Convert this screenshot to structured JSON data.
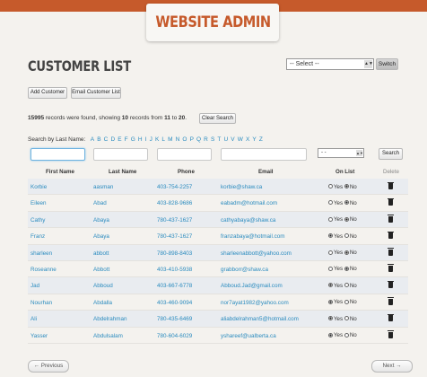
{
  "header": {
    "title": "WEBSITE ADMIN"
  },
  "page": {
    "title": "CUSTOMER LIST"
  },
  "site_select": {
    "value": "-- Select --",
    "switch_label": "Switch"
  },
  "actions": {
    "add": "Add Customer",
    "email": "Email Customer List",
    "clear": "Clear Search"
  },
  "summary": {
    "count": "15995",
    "text1": " records were found, showing ",
    "shown": "10",
    "text2": " records from ",
    "from": "11",
    "text3": " to ",
    "to": "20",
    "text4": "."
  },
  "alpha": {
    "label": "Search by Last Name:",
    "letters": [
      "A",
      "B",
      "C",
      "D",
      "E",
      "F",
      "G",
      "H",
      "I",
      "J",
      "K",
      "L",
      "M",
      "N",
      "O",
      "P",
      "Q",
      "R",
      "S",
      "T",
      "U",
      "V",
      "W",
      "X",
      "Y",
      "Z"
    ]
  },
  "filters": {
    "onlist_value": "- -",
    "search_label": "Search"
  },
  "columns": {
    "first": "First Name",
    "last": "Last Name",
    "phone": "Phone",
    "email": "Email",
    "onlist": "On List",
    "delete": "Delete"
  },
  "radio": {
    "yes": "Yes",
    "no": "No"
  },
  "rows": [
    {
      "first": "Korbie",
      "last": "aasman",
      "phone": "403-754-2257",
      "email": "korbie@shaw.ca",
      "on_list": "No"
    },
    {
      "first": "Eileen",
      "last": "Abad",
      "phone": "403-828-9686",
      "email": "eabadm@hotmail.com",
      "on_list": "No"
    },
    {
      "first": "Cathy",
      "last": "Abaya",
      "phone": "780-437-1627",
      "email": "cathyabaya@shaw.ca",
      "on_list": "No"
    },
    {
      "first": "Franz",
      "last": "Abaya",
      "phone": "780-437-1627",
      "email": "franzabaya@hotmail.com",
      "on_list": "Yes"
    },
    {
      "first": "sharleen",
      "last": "abbott",
      "phone": "780-898-8403",
      "email": "sharleenabbott@yahoo.com",
      "on_list": "No"
    },
    {
      "first": "Roseanne",
      "last": "Abbott",
      "phone": "403-410-5938",
      "email": "grabborr@shaw.ca",
      "on_list": "No"
    },
    {
      "first": "Jad",
      "last": "Abboud",
      "phone": "403-667-6778",
      "email": "Abboud.Jad@gmail.com",
      "on_list": "Yes"
    },
    {
      "first": "Nourhan",
      "last": "Abdalla",
      "phone": "403-460-9094",
      "email": "nor7ayat1982@yahoo.com",
      "on_list": "Yes"
    },
    {
      "first": "Ali",
      "last": "Abdelrahman",
      "phone": "780-435-6469",
      "email": "aliabdelrahman5@hotmail.com",
      "on_list": "Yes"
    },
    {
      "first": "Yasser",
      "last": "Abdulsalam",
      "phone": "780-604-6029",
      "email": "yshareef@ualberta.ca",
      "on_list": "Yes"
    }
  ],
  "pager": {
    "prev": "← Previous",
    "next": "Next →"
  }
}
